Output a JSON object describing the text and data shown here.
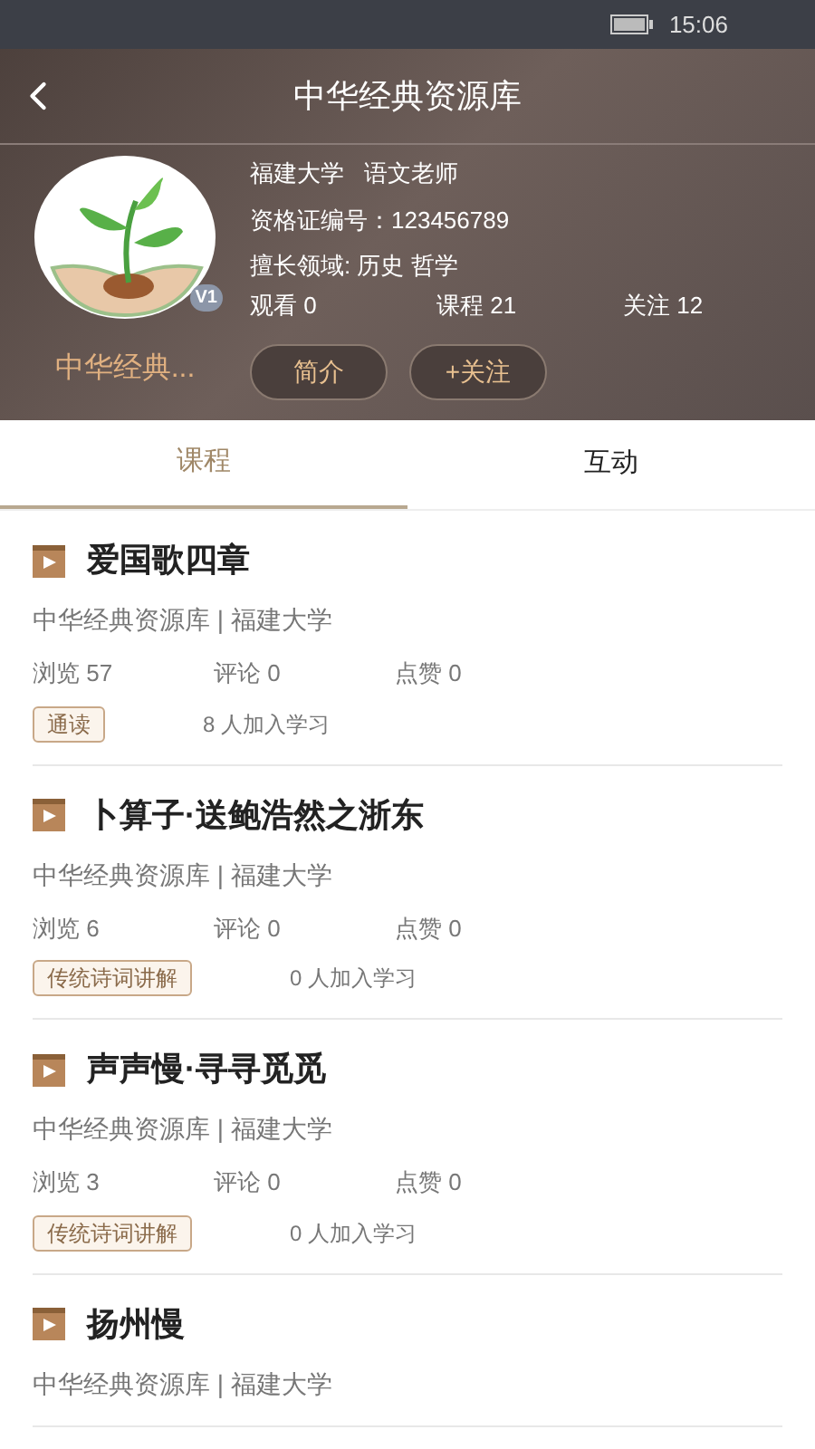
{
  "status_bar": {
    "time": "15:06"
  },
  "header": {
    "title": "中华经典资源库"
  },
  "profile": {
    "name": "中华经典...",
    "badge": "V1",
    "school_role": "福建大学   语文老师",
    "certificate": "资格证编号：123456789",
    "expertise": "擅长领域: 历史 哲学",
    "stats": [
      "观看 0",
      "课程 21",
      "关注 12"
    ],
    "buttons": [
      "简介",
      "+关注"
    ]
  },
  "tabs": [
    {
      "label": "课程",
      "selected": true
    },
    {
      "label": "互动",
      "selected": false
    }
  ],
  "courses": [
    {
      "title": "爱国歌四章",
      "source": "中华经典资源库 | 福建大学",
      "stats": [
        "浏览 57",
        "评论 0",
        "点赞 0"
      ],
      "tag": "通读",
      "learners": "8 人加入学习"
    },
    {
      "title": "卜算子·送鲍浩然之浙东",
      "source": "中华经典资源库 | 福建大学",
      "stats": [
        "浏览 6",
        "评论 0",
        "点赞 0"
      ],
      "tag": "传统诗词讲解",
      "learners": "0 人加入学习"
    },
    {
      "title": "声声慢·寻寻觅觅",
      "source": "中华经典资源库 | 福建大学",
      "stats": [
        "浏览 3",
        "评论 0",
        "点赞 0"
      ],
      "tag": "传统诗词讲解",
      "learners": "0 人加入学习"
    },
    {
      "title": "扬州慢",
      "source": "中华经典资源库 | 福建大学"
    }
  ]
}
